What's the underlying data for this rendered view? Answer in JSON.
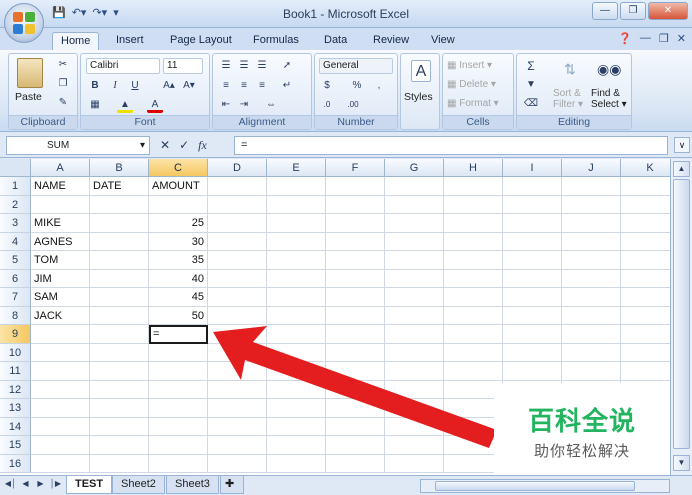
{
  "window": {
    "title": "Book1 - Microsoft Excel"
  },
  "tabs": [
    "Home",
    "Insert",
    "Page Layout",
    "Formulas",
    "Data",
    "Review",
    "View"
  ],
  "ribbon": {
    "clipboard": {
      "label": "Clipboard",
      "paste": "Paste"
    },
    "font": {
      "label": "Font",
      "name": "Calibri",
      "size": "11",
      "bold": "B",
      "italic": "I",
      "underline": "U"
    },
    "alignment": {
      "label": "Alignment"
    },
    "number": {
      "label": "Number",
      "format": "General",
      "percent": "%"
    },
    "styles": {
      "label": "Styles"
    },
    "cells": {
      "label": "Cells",
      "insert": "Insert",
      "delete": "Delete",
      "format": "Format"
    },
    "editing": {
      "label": "Editing",
      "sort": "Sort &",
      "filter": "Filter",
      "find": "Find &",
      "select": "Select"
    }
  },
  "formula_bar": {
    "name_box": "SUM",
    "fx": "fx",
    "content": "="
  },
  "columns": [
    "A",
    "B",
    "C",
    "D",
    "E",
    "F",
    "G",
    "H",
    "I",
    "J",
    "K"
  ],
  "rows": [
    "1",
    "2",
    "3",
    "4",
    "5",
    "6",
    "7",
    "8",
    "9",
    "10",
    "11",
    "12",
    "13",
    "14",
    "15",
    "16"
  ],
  "cells": {
    "A1": "NAME",
    "B1": "DATE",
    "C1": "AMOUNT",
    "A3": "MIKE",
    "C3": "25",
    "A4": "AGNES",
    "C4": "30",
    "A5": "TOM",
    "C5": "35",
    "A6": "JIM",
    "C6": "40",
    "A7": "SAM",
    "C7": "45",
    "A8": "JACK",
    "C8": "50",
    "C9": "="
  },
  "sheets": [
    "TEST",
    "Sheet2",
    "Sheet3"
  ],
  "watermark": {
    "title": "百科全说",
    "subtitle": "助你轻松解决"
  },
  "colors": {
    "accent": "#2b579a",
    "selection": "#f5c761",
    "arrow": "#e41e1e",
    "watermark_green": "#23b45f"
  }
}
